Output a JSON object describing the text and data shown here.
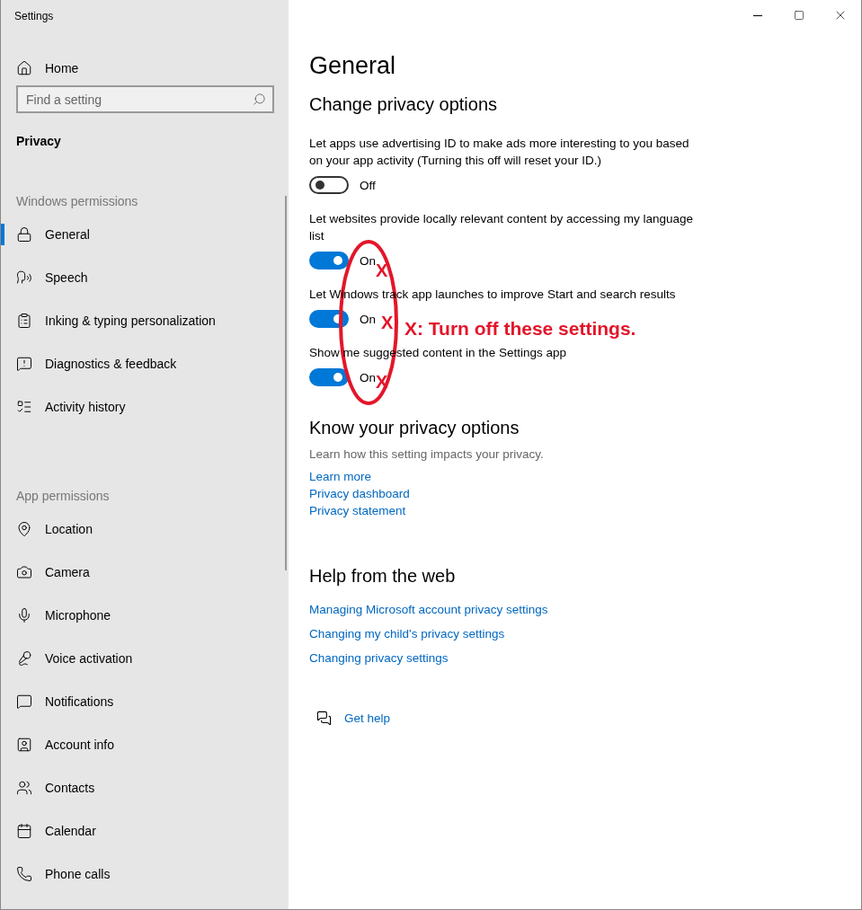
{
  "window": {
    "title": "Settings"
  },
  "sidebar": {
    "home": "Home",
    "search": {
      "placeholder": "Find a setting"
    },
    "category": "Privacy",
    "sections": [
      {
        "heading": "Windows permissions",
        "items": [
          {
            "label": "General",
            "selected": true
          },
          {
            "label": "Speech",
            "selected": false
          },
          {
            "label": "Inking & typing personalization",
            "selected": false
          },
          {
            "label": "Diagnostics & feedback",
            "selected": false
          },
          {
            "label": "Activity history",
            "selected": false
          }
        ]
      },
      {
        "heading": "App permissions",
        "items": [
          {
            "label": "Location",
            "selected": false
          },
          {
            "label": "Camera",
            "selected": false
          },
          {
            "label": "Microphone",
            "selected": false
          },
          {
            "label": "Voice activation",
            "selected": false
          },
          {
            "label": "Notifications",
            "selected": false
          },
          {
            "label": "Account info",
            "selected": false
          },
          {
            "label": "Contacts",
            "selected": false
          },
          {
            "label": "Calendar",
            "selected": false
          },
          {
            "label": "Phone calls",
            "selected": false
          }
        ]
      }
    ]
  },
  "main": {
    "title": "General",
    "privacy_options": {
      "heading": "Change privacy options",
      "toggles": [
        {
          "label": "Let apps use advertising ID to make ads more interesting to you based on your app activity (Turning this off will reset your ID.)",
          "on": false,
          "state_label": "Off"
        },
        {
          "label": "Let websites provide locally relevant content by accessing my language list",
          "on": true,
          "state_label": "On"
        },
        {
          "label": "Let Windows track app launches to improve Start and search results",
          "on": true,
          "state_label": "On"
        },
        {
          "label": "Show me suggested content in the Settings app",
          "on": true,
          "state_label": "On"
        }
      ]
    },
    "know": {
      "heading": "Know your privacy options",
      "description": "Learn how this setting impacts your privacy.",
      "links": [
        "Learn more",
        "Privacy dashboard",
        "Privacy statement"
      ]
    },
    "help": {
      "heading": "Help from the web",
      "links": [
        "Managing Microsoft account privacy settings",
        "Changing my child's privacy settings",
        "Changing privacy settings"
      ]
    },
    "get_help": "Get help"
  },
  "annotation": {
    "marks": [
      "X",
      "X",
      "X"
    ],
    "note": "X: Turn off these settings."
  }
}
